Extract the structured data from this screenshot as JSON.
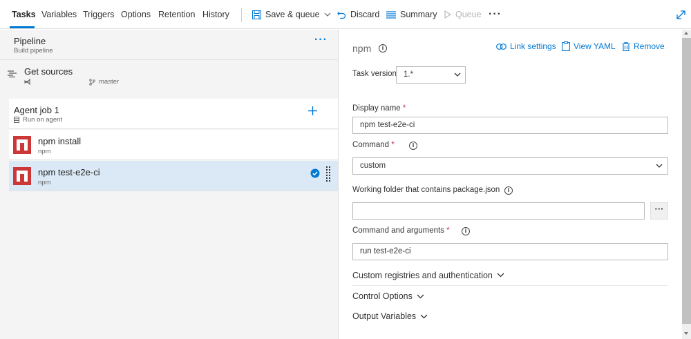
{
  "tabs": [
    {
      "label": "Tasks"
    },
    {
      "label": "Variables"
    },
    {
      "label": "Triggers"
    },
    {
      "label": "Options"
    },
    {
      "label": "Retention"
    },
    {
      "label": "History"
    }
  ],
  "toolbar": {
    "save_queue": "Save & queue",
    "discard": "Discard",
    "summary": "Summary",
    "queue": "Queue",
    "more": "···"
  },
  "pipeline": {
    "title": "Pipeline",
    "subtitle": "Build pipeline",
    "more": "···"
  },
  "get_sources": {
    "title": "Get sources",
    "branch": "master"
  },
  "agent_job": {
    "title": "Agent job 1",
    "subtitle": "Run on agent"
  },
  "tasks": [
    {
      "title": "npm install",
      "subtitle": "npm",
      "selected": false
    },
    {
      "title": "npm test-e2e-ci",
      "subtitle": "npm",
      "selected": true
    }
  ],
  "detail": {
    "title": "npm",
    "link_settings": "Link settings",
    "view_yaml": "View YAML",
    "remove": "Remove",
    "task_version_label": "Task version",
    "task_version_value": "1.*",
    "display_name_label": "Display name",
    "display_name_value": "npm test-e2e-ci",
    "command_label": "Command",
    "command_value": "custom",
    "working_folder_label": "Working folder that contains package.json",
    "working_folder_value": "",
    "browse": "···",
    "command_args_label": "Command and arguments",
    "command_args_value": "run test-e2e-ci",
    "required_mark": "*",
    "info_glyph": "i",
    "sections": [
      {
        "label": "Custom registries and authentication"
      },
      {
        "label": "Control Options"
      },
      {
        "label": "Output Variables"
      }
    ]
  },
  "colors": {
    "accent": "#0078d4",
    "selected_row": "#dbe9f6",
    "npm_red": "#cb3837",
    "required": "#c4314b"
  }
}
